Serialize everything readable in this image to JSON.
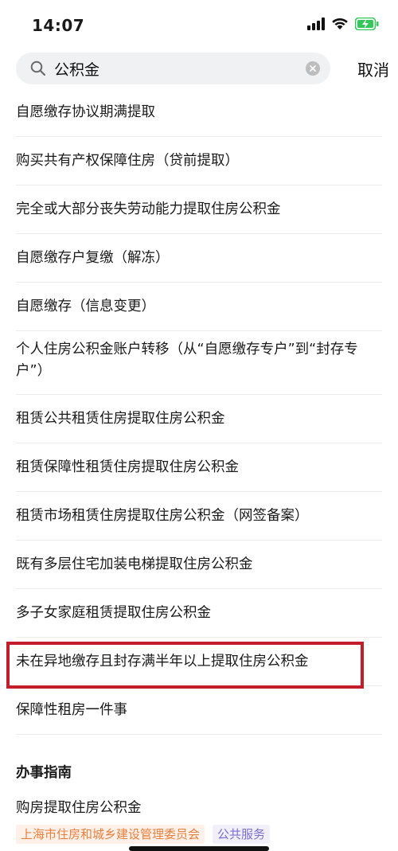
{
  "status_bar": {
    "time": "14:07"
  },
  "search": {
    "query": "公积金",
    "cancel_label": "取消"
  },
  "results": [
    "自愿缴存协议期满提取",
    "购买共有产权保障住房（贷前提取）",
    "完全或大部分丧失劳动能力提取住房公积金",
    "自愿缴存户复缴（解冻）",
    "自愿缴存（信息变更）",
    "个人住房公积金账户转移（从“自愿缴存专户”到“封存专户”）",
    "租赁公共租赁住房提取住房公积金",
    "租赁保障性租赁住房提取住房公积金",
    "租赁市场租赁住房提取住房公积金（网签备案）",
    "既有多层住宅加装电梯提取住房公积金",
    "多子女家庭租赁提取住房公积金",
    "未在异地缴存且封存满半年以上提取住房公积金",
    "保障性租房一件事"
  ],
  "guide": {
    "section_title": "办事指南",
    "item_title": "购房提取住房公积金",
    "tags": [
      "上海市住房和城乡建设管理委员会",
      "公共服务"
    ]
  },
  "colors": {
    "highlight": "#c41d2a",
    "battery": "#34c759"
  },
  "icons": [
    "signal-icon",
    "wifi-icon",
    "battery-charging-icon",
    "search-icon",
    "clear-icon"
  ]
}
